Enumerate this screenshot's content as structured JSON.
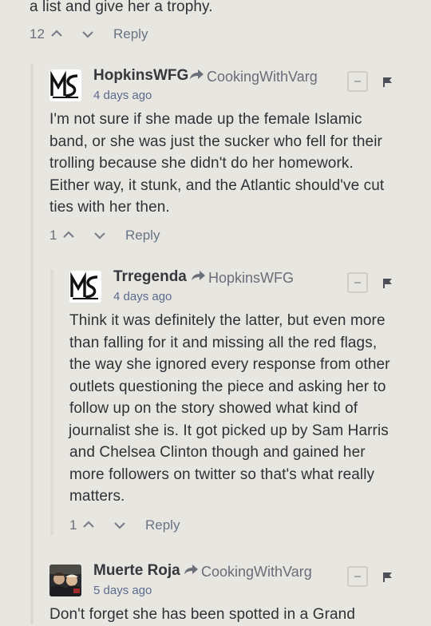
{
  "colors": {
    "background": "#e8e6e1",
    "text": "#2f3136",
    "meta": "#686d78",
    "timestamp": "#5c6a8c",
    "thread_line": "#dddbd6"
  },
  "top_comment": {
    "text_tail": "a list and give her a trophy.",
    "votes": "12",
    "reply_label": "Reply"
  },
  "comments": [
    {
      "username": "HopkinsWFG",
      "parent": "CookingWithVarg",
      "time": "4 days ago",
      "avatar_icon": "ms-logo-icon",
      "lines": [
        "I'm not sure if she made up the female Islamic",
        "band, or she was just the sucker who fell for their",
        "trolling because she didn't do her homework.",
        "Either way, it stunk, and the Atlantic should've cut",
        "ties with her then."
      ],
      "votes": "1",
      "reply_label": "Reply"
    },
    {
      "username": "Trregenda",
      "parent": "HopkinsWFG",
      "time": "4 days ago",
      "avatar_icon": "ms-logo-icon",
      "lines": [
        "Think it was definitely the latter, but even more",
        "than falling for it and missing all the red flags,",
        "the way she ignored every response from other",
        "outlets questioning the piece and asking her to",
        "follow up on the story showed what kind of",
        "journalist she is. It got picked up by Sam Harris",
        "and Chelsea Clinton though and gained her",
        "more followers on twitter so that's what really",
        "matters."
      ],
      "votes": "1",
      "reply_label": "Reply"
    },
    {
      "username": "Muerte Roja",
      "parent": "CookingWithVarg",
      "time": "5 days ago",
      "avatar_icon": "user-photo-avatar",
      "lines": [
        "Don't forget she has been spotted in a Grand"
      ]
    }
  ]
}
